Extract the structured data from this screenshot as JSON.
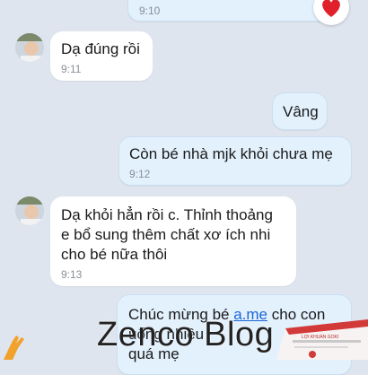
{
  "messages": [
    {
      "sender": "me",
      "text": "",
      "time": "9:10"
    },
    {
      "sender": "contact",
      "text": "Dạ đúng rồi",
      "time": "9:11"
    },
    {
      "sender": "me",
      "text": "Vâng",
      "time": ""
    },
    {
      "sender": "me",
      "text": "Còn bé nhà mjk khỏi chưa mẹ",
      "time": "9:12"
    },
    {
      "sender": "contact",
      "text": "Dạ khỏi hẳn rồi c. Thỉnh thoảng\ne bổ sung thêm chất xơ ích nhi\ncho bé nữa thôi",
      "time": "9:13"
    },
    {
      "sender": "me",
      "text_before": "Chúc mừng bé ",
      "link": "a.me",
      "text_after": " cho con\nuống nhiều\nquá mẹ",
      "time": ""
    }
  ],
  "reaction": {
    "icon": "heart-icon",
    "color": "#e0202a"
  },
  "watermark": {
    "text": "Zenco Blog"
  },
  "product": {
    "label": "LỢI KHUẨN GOKI"
  },
  "colors": {
    "background": "#dfe5ee",
    "incoming": "#ffffff",
    "outgoing": "#e3f1fd",
    "link": "#1b66d8"
  }
}
